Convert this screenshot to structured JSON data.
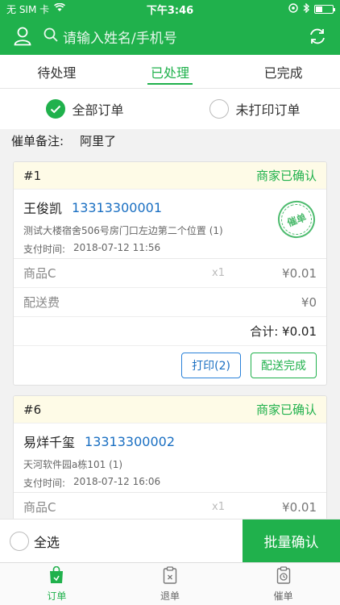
{
  "status_bar": {
    "carrier": "无 SIM 卡",
    "time": "下午3:46"
  },
  "header": {
    "search_placeholder": "请输入姓名/手机号",
    "icons": [
      "user-icon",
      "search-icon",
      "refresh-icon"
    ]
  },
  "tabs": [
    {
      "label": "待处理",
      "active": false
    },
    {
      "label": "已处理",
      "active": true
    },
    {
      "label": "已完成",
      "active": false
    }
  ],
  "filters": {
    "all_orders": "全部订单",
    "unprinted_orders": "未打印订单",
    "selected": "all_orders"
  },
  "note": {
    "label": "催单备注:",
    "value": "阿里了"
  },
  "orders": [
    {
      "number": "#1",
      "status": "商家已确认",
      "name": "王俊凯",
      "phone": "13313300001",
      "address": "测试大楼宿舍506号房门口左边第二个位置 (1)",
      "time_label": "支付时间:",
      "time": "2018-07-12 11:56",
      "stamp_text": "催单",
      "items": [
        {
          "label": "商品C",
          "qty": "x1",
          "price": "¥0.01"
        },
        {
          "label": "配送费",
          "qty": "",
          "price": "¥0"
        }
      ],
      "total": "合计: ¥0.01",
      "print_label": "打印(2)",
      "complete_label": "配送完成"
    },
    {
      "number": "#6",
      "status": "商家已确认",
      "name": "易烊千玺",
      "phone": "13313300002",
      "address": "天河软件园a栋101 (1)",
      "time_label": "支付时间:",
      "time": "2018-07-12 16:06",
      "items": [
        {
          "label": "商品C",
          "qty": "x1",
          "price": "¥0.01"
        }
      ]
    }
  ],
  "bottom": {
    "select_all": "全选",
    "batch_confirm": "批量确认"
  },
  "tabbar": [
    {
      "label": "订单",
      "icon": "bag-icon",
      "active": true
    },
    {
      "label": "退单",
      "icon": "clipboard-icon",
      "active": false
    },
    {
      "label": "催单",
      "icon": "clock-icon",
      "active": false
    }
  ],
  "colors": {
    "primary": "#20b14c",
    "link": "#1a6fc2",
    "head_bg": "#fefbe7"
  }
}
